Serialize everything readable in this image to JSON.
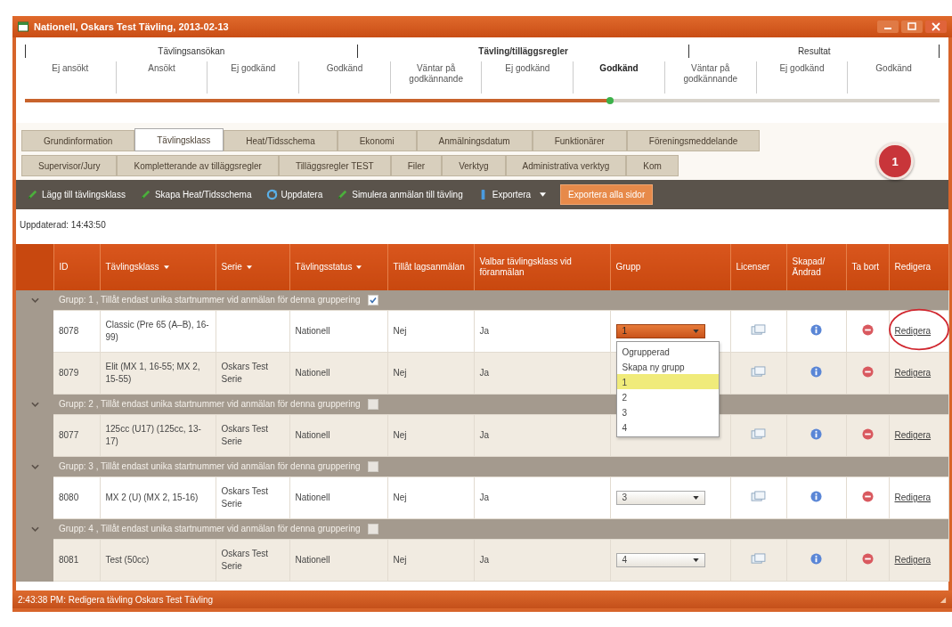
{
  "window": {
    "title": "Nationell, Oskars Test Tävling, 2013-02-13"
  },
  "stepper": {
    "phases": [
      {
        "label": "Tävlingsansökan",
        "current": false
      },
      {
        "label": "Tävling/tilläggsregler",
        "current": true
      },
      {
        "label": "Resultat",
        "current": false
      }
    ],
    "steps": [
      {
        "label": "Ej ansökt",
        "current": false
      },
      {
        "label": "Ansökt",
        "current": false
      },
      {
        "label": "Ej godkänd",
        "current": false
      },
      {
        "label": "Godkänd",
        "current": false
      },
      {
        "label": "Väntar på godkännande",
        "current": false
      },
      {
        "label": "Ej godkänd",
        "current": false
      },
      {
        "label": "Godkänd",
        "current": true
      },
      {
        "label": "Väntar på godkännande",
        "current": false
      },
      {
        "label": "Ej godkänd",
        "current": false
      },
      {
        "label": "Godkänd",
        "current": false
      }
    ],
    "level": 0.64
  },
  "tabs": [
    [
      {
        "label": "Grundinformation",
        "selected": false
      },
      {
        "label": "Tävlingsklass",
        "selected": true
      },
      {
        "label": "Heat/Tidsschema",
        "selected": false
      },
      {
        "label": "Ekonomi",
        "selected": false
      },
      {
        "label": "Anmälningsdatum",
        "selected": false
      },
      {
        "label": "Funktionärer",
        "selected": false
      },
      {
        "label": "Föreningsmeddelande",
        "selected": false
      }
    ],
    [
      {
        "label": "Supervisor/Jury",
        "selected": false
      },
      {
        "label": "Kompletterande av tilläggsregler",
        "selected": false
      },
      {
        "label": "Tilläggsregler TEST",
        "selected": false
      },
      {
        "label": "Filer",
        "selected": false
      },
      {
        "label": "Verktyg",
        "selected": false
      },
      {
        "label": "Administrativa verktyg",
        "selected": false
      },
      {
        "label": "Kom",
        "selected": false
      }
    ]
  ],
  "badge": "1",
  "toolbar": [
    {
      "label": "Lägg till tävlingsklass",
      "kind": "add"
    },
    {
      "label": "Skapa Heat/Tidsschema",
      "kind": "add"
    },
    {
      "label": "Uppdatera",
      "kind": "refresh"
    },
    {
      "label": "Simulera anmälan till tävling",
      "kind": "add"
    },
    {
      "label": "Exportera",
      "kind": "menu"
    },
    {
      "label": "Exportera alla sidor",
      "kind": "primary"
    }
  ],
  "updated": "Uppdaterad: 14:43:50",
  "table": {
    "columns": [
      {
        "label": "ID",
        "sortable": false
      },
      {
        "label": "Tävlingsklass",
        "sortable": true
      },
      {
        "label": "Serie",
        "sortable": true
      },
      {
        "label": "Tävlingsstatus",
        "sortable": true
      },
      {
        "label": "Tillåt lagsanmälan",
        "sortable": false
      },
      {
        "label": "Valbar tävlingsklass vid föranmälan",
        "sortable": false
      },
      {
        "label": "Grupp",
        "sortable": false
      },
      {
        "label": "Licenser",
        "sortable": false
      },
      {
        "label": "Skapad/ Ändrad",
        "sortable": false
      },
      {
        "label": "Ta bort",
        "sortable": false
      },
      {
        "label": "Redigera",
        "sortable": false
      }
    ],
    "groups": [
      {
        "label": "Grupp: 1 , Tillåt endast unika startnummer vid anmälan för denna gruppering",
        "checked": true,
        "rows": [
          {
            "id": "8078",
            "class": "Classic (Pre 65 (A–B), 16-99)",
            "series": "",
            "status": "Nationell",
            "team": "Nej",
            "selectable": "Ja",
            "group": {
              "value": "1",
              "open": true
            },
            "edit": "Redigera",
            "circled": true
          },
          {
            "id": "8079",
            "class": "Elit (MX 1, 16-55; MX 2, 15-55)",
            "series": "Oskars Test Serie",
            "status": "Nationell",
            "team": "Nej",
            "selectable": "Ja",
            "edit": "Redigera",
            "circled": false
          }
        ]
      },
      {
        "label": "Grupp: 2 , Tillåt endast unika startnummer vid anmälan för denna gruppering",
        "checked": false,
        "rows": [
          {
            "id": "8077",
            "class": "125cc (U17) (125cc, 13-17)",
            "series": "Oskars Test Serie",
            "status": "Nationell",
            "team": "Nej",
            "selectable": "Ja",
            "edit": "Redigera",
            "circled": false
          }
        ]
      },
      {
        "label": "Grupp: 3 , Tillåt endast unika startnummer vid anmälan för denna gruppering",
        "checked": false,
        "rows": [
          {
            "id": "8080",
            "class": "MX 2 (U) (MX 2, 15-16)",
            "series": "Oskars Test Serie",
            "status": "Nationell",
            "team": "Nej",
            "selectable": "Ja",
            "group": {
              "value": "3",
              "open": false
            },
            "edit": "Redigera",
            "circled": false
          }
        ]
      },
      {
        "label": "Grupp: 4 , Tillåt endast unika startnummer vid anmälan för denna gruppering",
        "checked": false,
        "rows": [
          {
            "id": "8081",
            "class": "Test (50cc)",
            "series": "Oskars Test Serie",
            "status": "Nationell",
            "team": "Nej",
            "selectable": "Ja",
            "group": {
              "value": "4",
              "open": false
            },
            "edit": "Redigera",
            "circled": false
          }
        ]
      }
    ],
    "dropdown_options": [
      {
        "label": "Ogrupperad",
        "selected": false
      },
      {
        "label": "Skapa ny grupp",
        "selected": false
      },
      {
        "label": "1",
        "selected": true
      },
      {
        "label": "2",
        "selected": false
      },
      {
        "label": "3",
        "selected": false
      },
      {
        "label": "4",
        "selected": false
      }
    ]
  },
  "status_bar": "2:43:38 PM: Redigera tävling Oskars Test Tävling"
}
